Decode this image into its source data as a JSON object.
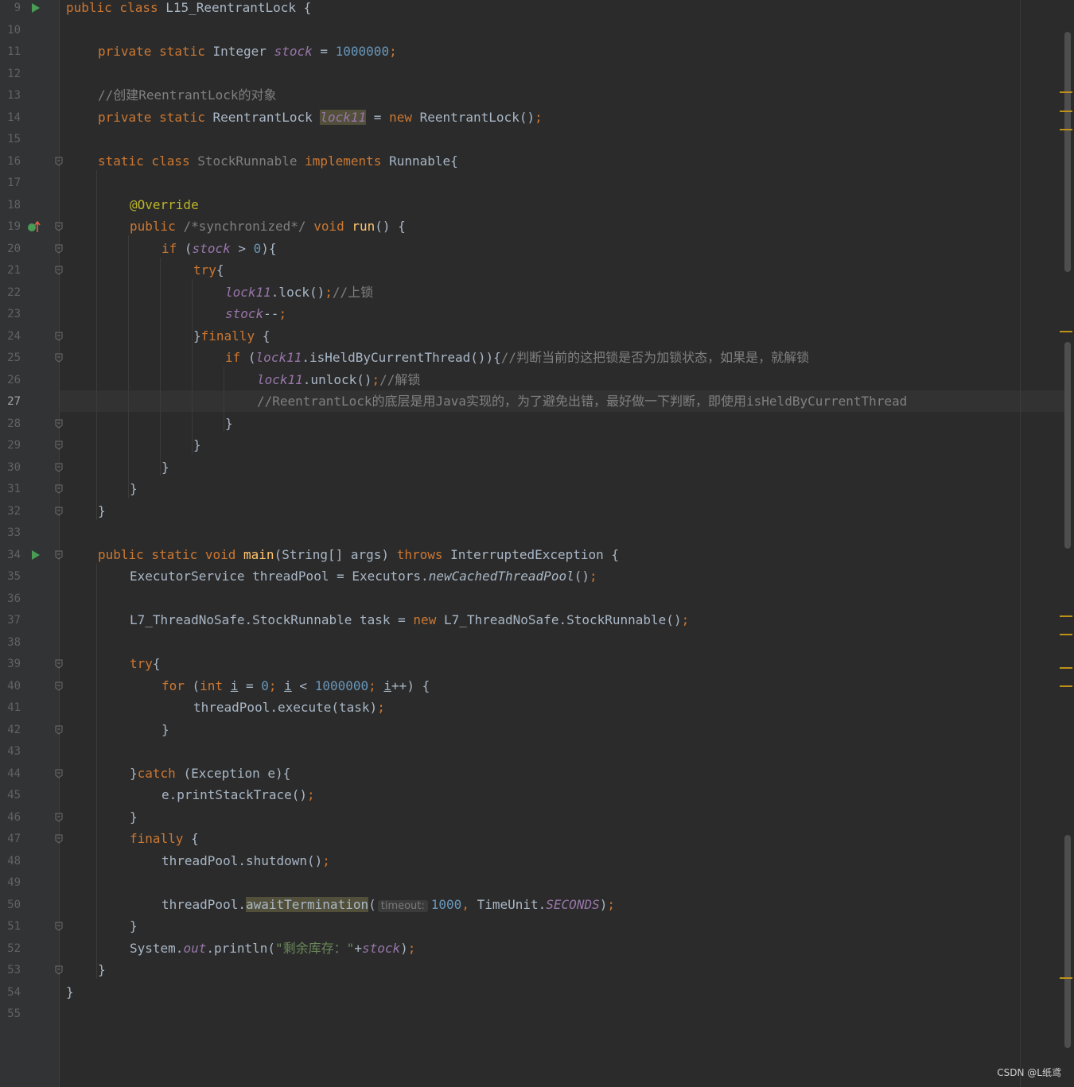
{
  "colors": {
    "background": "#2b2b2b",
    "gutter": "#313335",
    "keyword": "#cc7832",
    "number": "#6897bb",
    "string": "#6a8759",
    "comment": "#808080",
    "field": "#9876aa",
    "annotation": "#bbb529",
    "method": "#ffc66d"
  },
  "editor": {
    "current_line": "27",
    "line_numbers": [
      "9",
      "10",
      "11",
      "12",
      "13",
      "14",
      "15",
      "16",
      "17",
      "18",
      "19",
      "20",
      "21",
      "22",
      "23",
      "24",
      "25",
      "26",
      "27",
      "28",
      "29",
      "30",
      "31",
      "32",
      "33",
      "34",
      "35",
      "36",
      "37",
      "38",
      "39",
      "40",
      "41",
      "42",
      "43",
      "44",
      "45",
      "46",
      "47",
      "48",
      "49",
      "50",
      "51",
      "52",
      "53",
      "54",
      "55"
    ],
    "tokens": {
      "l9": {
        "a": "public class ",
        "b": "L15_ReentrantLock {"
      },
      "l11": {
        "a": "private static ",
        "b": "Integer ",
        "c": "stock",
        "d": " = ",
        "e": "1000000",
        "f": ";"
      },
      "l13": {
        "a": "//创建ReentrantLock的对象"
      },
      "l14": {
        "a": "private static ",
        "b": "ReentrantLock ",
        "c": "lock11",
        "d": " = ",
        "e": "new ",
        "f": "ReentrantLock()",
        "g": ";"
      },
      "l16": {
        "a": "static class ",
        "b": "StockRunnable ",
        "c": "implements ",
        "d": "Runnable{"
      },
      "l18": {
        "a": "@Override"
      },
      "l19": {
        "a": "public ",
        "b": "/*synchronized*/ ",
        "c": "void ",
        "d": "run",
        "e": "() {"
      },
      "l20": {
        "a": "if ",
        "b": "(",
        "c": "stock",
        "d": " > ",
        "e": "0",
        "f": "){"
      },
      "l21": {
        "a": "try",
        "b": "{"
      },
      "l22": {
        "a": "lock11",
        "b": ".lock()",
        "c": ";",
        "d": "//上锁"
      },
      "l23": {
        "a": "stock",
        "b": "--",
        "c": ";"
      },
      "l24": {
        "a": "}",
        "b": "finally ",
        "c": "{"
      },
      "l25": {
        "a": "if ",
        "b": "(",
        "c": "lock11",
        "d": ".isHeldByCurrentThread()){",
        "e": "//判断当前的这把锁是否为加锁状态，如果是，就解锁"
      },
      "l26": {
        "a": "lock11",
        "b": ".unlock()",
        "c": ";",
        "d": "//解锁"
      },
      "l27": {
        "a": "//ReentrantLock的底层是用Java实现的，为了避免出错，最好做一下判断，即使用isHeldByCurrentThread"
      },
      "l28": {
        "a": "}"
      },
      "l29": {
        "a": "}"
      },
      "l30": {
        "a": "}"
      },
      "l31": {
        "a": "}"
      },
      "l32": {
        "a": "}"
      },
      "l34": {
        "a": "public static void ",
        "b": "main",
        "c": "(String[] args) ",
        "d": "throws ",
        "e": "InterruptedException {"
      },
      "l35": {
        "a": "ExecutorService threadPool = Executors.",
        "b": "newCachedThreadPool",
        "c": "()",
        "d": ";"
      },
      "l37": {
        "a": "L7_ThreadNoSafe.StockRunnable task = ",
        "b": "new ",
        "c": "L7_ThreadNoSafe.StockRunnable()",
        "d": ";"
      },
      "l39": {
        "a": "try",
        "b": "{"
      },
      "l40": {
        "a": "for ",
        "b": "(",
        "c": "int ",
        "d": "i",
        "e": " = ",
        "f": "0",
        "g": "; ",
        "h": "i",
        "i": " < ",
        "j": "1000000",
        "k": "; ",
        "l": "i",
        "m": "++) {"
      },
      "l41": {
        "a": "threadPool.execute(task)",
        "b": ";"
      },
      "l42": {
        "a": "}"
      },
      "l44": {
        "a": "}",
        "b": "catch ",
        "c": "(Exception e){"
      },
      "l45": {
        "a": "e.printStackTrace()",
        "b": ";"
      },
      "l46": {
        "a": "}"
      },
      "l47": {
        "a": "finally ",
        "b": "{"
      },
      "l48": {
        "a": "threadPool.shutdown()",
        "b": ";"
      },
      "l50": {
        "a": "threadPool.",
        "b": "awaitTermination",
        "c": "(",
        "hint": "timeout:",
        "d": "1000",
        "e": ", ",
        "f": "TimeUnit.",
        "g": "SECONDS",
        "h": ")",
        "i": ";"
      },
      "l51": {
        "a": "}"
      },
      "l52": {
        "a": "System.",
        "b": "out",
        "c": ".println(",
        "d": "\"剩余库存：\"",
        "e": "+",
        "f": "stock",
        "g": ")",
        "h": ";"
      },
      "l53": {
        "a": "}"
      },
      "l54": {
        "a": "}"
      }
    }
  },
  "icons": {
    "run": "run-icon",
    "override": "override-up-arrow-icon",
    "fold": "fold-marker-icon"
  },
  "watermark": "CSDN @L纸鸢"
}
